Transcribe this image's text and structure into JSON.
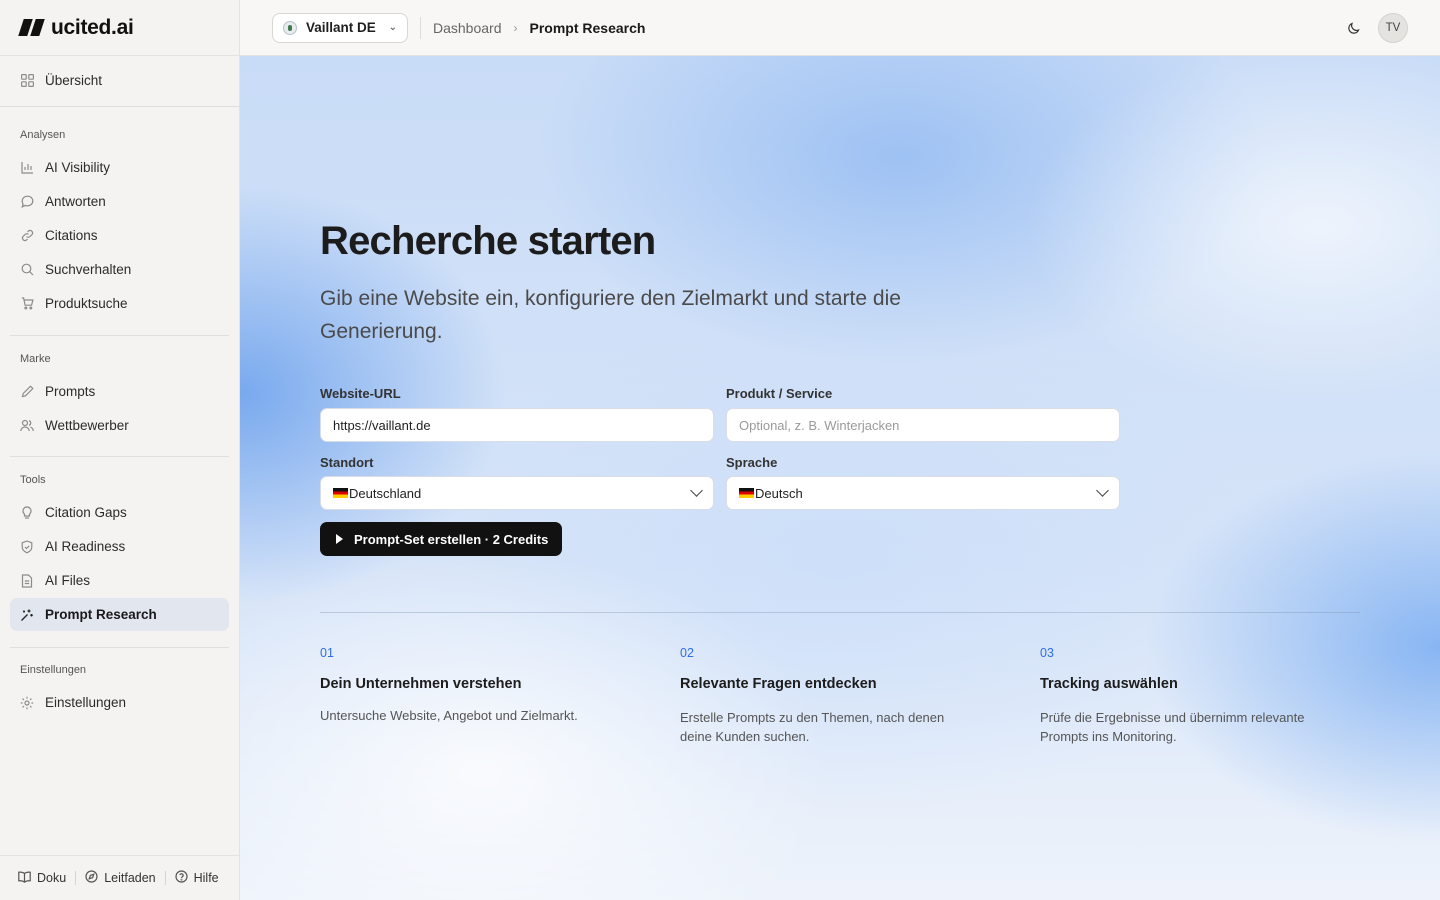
{
  "app": {
    "logo_text": "ucited.ai"
  },
  "sidebar": {
    "overview": {
      "label": "Übersicht",
      "icon": "grid-icon"
    },
    "sections": [
      {
        "label": "Analysen",
        "items": [
          {
            "label": "AI Visibility",
            "icon": "bar-chart-icon"
          },
          {
            "label": "Antworten",
            "icon": "chat-bubble-icon"
          },
          {
            "label": "Citations",
            "icon": "link-icon"
          },
          {
            "label": "Suchverhalten",
            "icon": "search-icon"
          },
          {
            "label": "Produktsuche",
            "icon": "cart-icon"
          }
        ]
      },
      {
        "label": "Marke",
        "items": [
          {
            "label": "Prompts",
            "icon": "tag-icon"
          },
          {
            "label": "Wettbewerber",
            "icon": "users-icon"
          }
        ]
      },
      {
        "label": "Tools",
        "items": [
          {
            "label": "Citation Gaps",
            "icon": "lightbulb-icon"
          },
          {
            "label": "AI Readiness",
            "icon": "shield-icon"
          },
          {
            "label": "AI Files",
            "icon": "file-icon"
          },
          {
            "label": "Prompt Research",
            "icon": "sparkle-icon",
            "active": true
          }
        ]
      },
      {
        "label": "Einstellungen",
        "items": [
          {
            "label": "Einstellungen",
            "icon": "gear-icon"
          }
        ]
      }
    ],
    "footer": [
      {
        "label": "Doku",
        "icon": "book-icon"
      },
      {
        "label": "Leitfaden",
        "icon": "compass-icon"
      },
      {
        "label": "Hilfe",
        "icon": "help-icon"
      }
    ]
  },
  "topbar": {
    "project": "Vaillant DE",
    "breadcrumb": [
      "Dashboard",
      "Prompt Research"
    ],
    "avatar_initials": "TV"
  },
  "main": {
    "title": "Recherche starten",
    "subtitle": "Gib eine Website ein, konfiguriere den Zielmarkt und starte die Generierung.",
    "form": {
      "url_label": "Website-URL",
      "url_value": "https://vaillant.de",
      "product_label": "Produkt / Service",
      "product_placeholder": "Optional, z. B. Winterjacken",
      "location_label": "Standort",
      "location_value": "Deutschland",
      "language_label": "Sprache",
      "language_value": "Deutsch",
      "submit_label": "Prompt-Set erstellen · 2 Credits"
    },
    "steps": [
      {
        "num": "01",
        "title": "Dein Unternehmen verstehen",
        "desc": "Untersuche Website, Angebot und Zielmarkt."
      },
      {
        "num": "02",
        "title": "Relevante Fragen entdecken",
        "desc": "Erstelle Prompts zu den Themen, nach denen deine Kunden suchen."
      },
      {
        "num": "03",
        "title": "Tracking auswählen",
        "desc": "Prüfe die Ergebnisse und übernimm relevante Prompts ins Monitoring."
      }
    ]
  },
  "colors": {
    "accent": "#2f6fe0",
    "active_nav_bg": "#e2e6ef",
    "cta_bg": "#111111"
  }
}
